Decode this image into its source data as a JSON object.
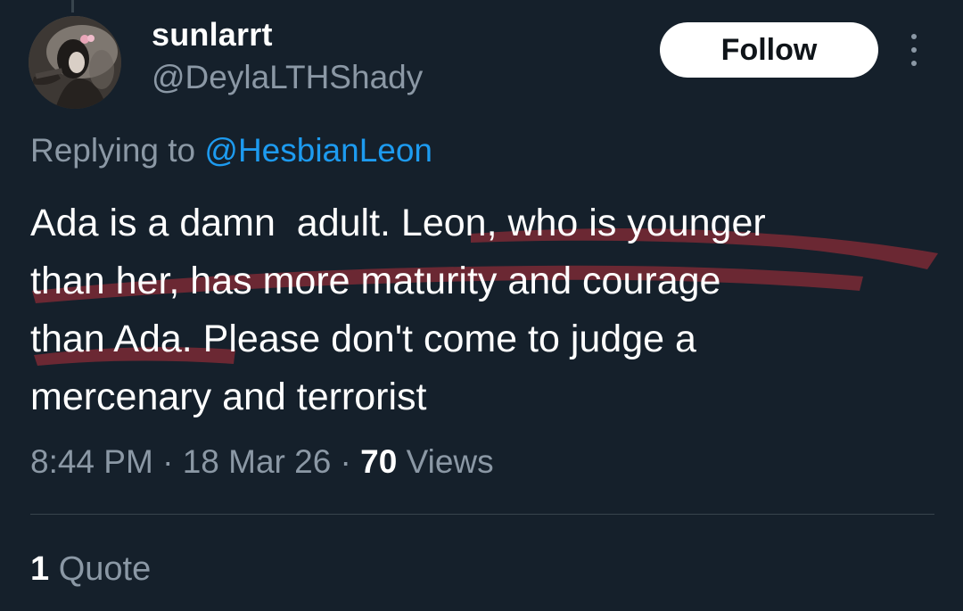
{
  "author": {
    "display_name": "sunlarrt",
    "handle": "@DeylaLTHShady"
  },
  "actions": {
    "follow_label": "Follow",
    "more_icon": "more-vertical-icon"
  },
  "reply": {
    "prefix": "Replying to ",
    "mention": "@HesbianLeon"
  },
  "tweet": {
    "lines": [
      "Ada is a damn  adult. Leon, who is younger",
      "than her, has more maturity and courage",
      "than Ada. Please don't come to judge a",
      "mercenary and terrorist"
    ]
  },
  "meta": {
    "time": "8:44 PM",
    "separator": " · ",
    "date": "18 Mar 26",
    "views_count": "70",
    "views_label": " Views"
  },
  "engagement": {
    "quote_count": "1",
    "quote_label": " Quote"
  },
  "colors": {
    "background": "#15202b",
    "text_primary": "#ffffff",
    "text_secondary": "#8b98a5",
    "link": "#1d9bf0",
    "highlight_mark": "#7a2a35",
    "follow_bg": "#ffffff"
  }
}
